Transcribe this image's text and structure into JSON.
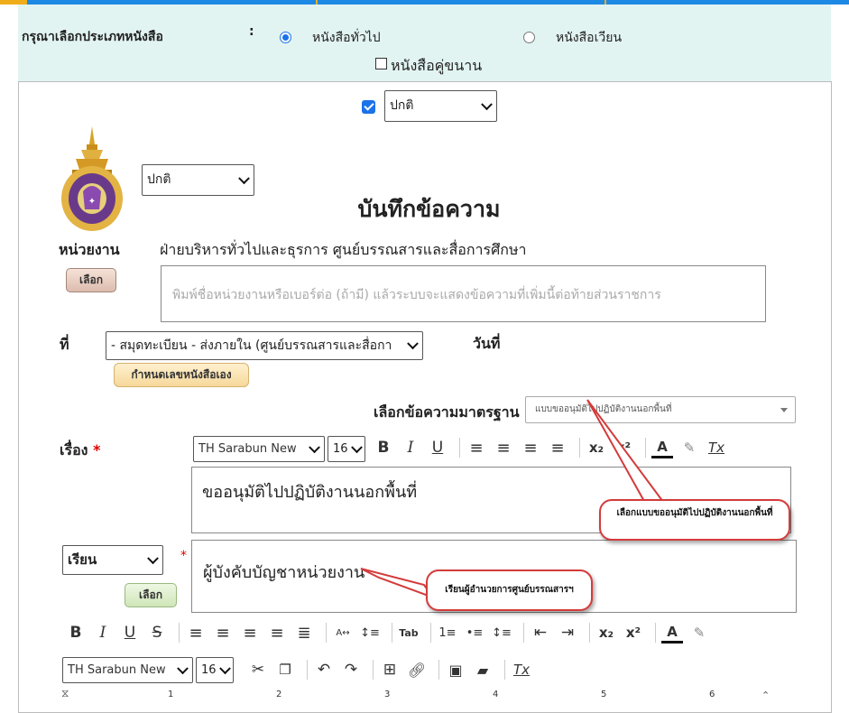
{
  "book_type": {
    "label": "กรุณาเลือกประเภทหนังสือ",
    "colon": ":",
    "options": [
      "หนังสือทั่วไป",
      "หนังสือเวียน"
    ],
    "selected": "หนังสือทั่วไป",
    "pair_checkbox_label": "หนังสือคู่ขนาน"
  },
  "urgency": {
    "checked": true,
    "value": "ปกติ"
  },
  "secrecy": {
    "value": "ปกติ"
  },
  "document": {
    "title": "บันทึกข้อความ",
    "org_label": "หน่วยงาน",
    "org_value": "ฝ่ายบริหารทั่วไปและธุรการ ศูนย์บรรณสารและสื่อการศึกษา",
    "choose_button": "เลือก",
    "org_placeholder": "พิมพ์ชื่อหน่วยงานหรือเบอร์ต่อ (ถ้ามี) แล้วระบบจะแสดงข้อความที่เพิ่มนี้ต่อท้ายส่วนราชการ",
    "ref_label": "ที่",
    "ref_value": "- สมุดทะเบียน - ส่งภายใน (ศูนย์บรรณสารและสื่อกา",
    "date_label": "วันที่",
    "own_number_button": "กำหนดเลขหนังสือเอง",
    "standard_label": "เลือกข้อความมาตรฐาน",
    "standard_value": "แบบขออนุมัติไปปฏิบัติงานนอกพื้นที่",
    "subject_label": "เรื่อง",
    "required_mark": "*",
    "font_family": "TH Sarabun New",
    "font_size": "16",
    "subject_text": "ขออนุมัติไปปฏิบัติงานนอกพื้นที่",
    "salutation_value": "เรียน",
    "addressee_text": "ผู้บังคับบัญชาหน่วยงาน",
    "choose_button_2": "เลือก"
  },
  "callouts": {
    "standard_hint": "เลือกแบบขออนุมัติไปปฏิบัติงานนอกพื้นที่",
    "addressee_hint": "เรียนผู้อำนวยการศูนย์บรรณสารฯ"
  },
  "toolbar": {
    "subject_icons": [
      "B",
      "I",
      "U",
      "≡",
      "≡",
      "≡",
      "≡",
      "x₂",
      "x²",
      "A",
      "✎",
      "Tx"
    ],
    "body_row1": [
      "B",
      "I",
      "U",
      "S",
      "≡",
      "≡",
      "≡",
      "≡",
      "≣",
      "A↔",
      "↕≡",
      "Tab",
      "1≡",
      "•≡",
      "↕≡",
      "⇤",
      "⇥",
      "x₂",
      "x²",
      "A",
      "✎"
    ],
    "body_font": "TH Sarabun New",
    "body_size": "16"
  },
  "ruler": {
    "marks": [
      "1",
      "2",
      "3",
      "4",
      "5",
      "6"
    ]
  },
  "colors": {
    "accent": "#1a73e8",
    "panel_bg": "#e2f4f2",
    "callout_border": "#d43b3b",
    "required": "#dd0000"
  }
}
